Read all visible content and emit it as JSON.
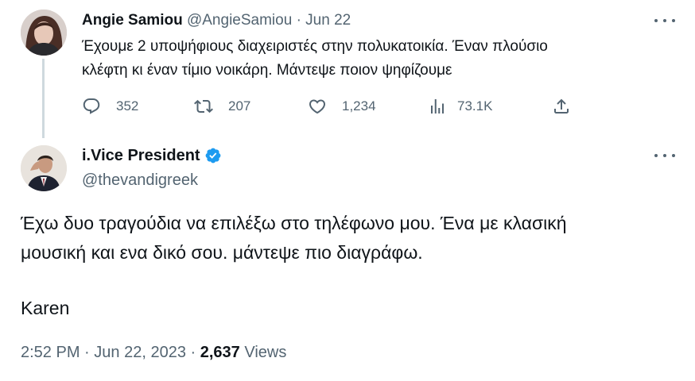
{
  "colors": {
    "text": "#0f1419",
    "secondary": "#536471",
    "verified": "#1d9bf0",
    "thread_line": "#cfd9de"
  },
  "reply_to": {
    "author_name": "Angie Samiou",
    "author_handle": "@AngieSamiou",
    "separator": "·",
    "date": "Jun 22",
    "text_line1": "Έχουμε 2 υποψήφιους διαχειριστές στην πολυκατοικία. Έναν πλούσιο",
    "text_line2": "κλέφτη κι έναν τίμιο νοικάρη. Μάντεψε ποιον ψηφίζουμε",
    "actions": [
      {
        "icon": "reply-icon",
        "count": "352"
      },
      {
        "icon": "retweet-icon",
        "count": "207"
      },
      {
        "icon": "like-icon",
        "count": "1,234"
      },
      {
        "icon": "views-icon",
        "count": "73.1K"
      },
      {
        "icon": "share-icon",
        "count": ""
      }
    ]
  },
  "tweet": {
    "author_name": "i.Vice President",
    "author_handle": "@thevandigreek",
    "verified": true,
    "text_line1": "Έχω δυο τραγούδια να επιλέξω στο τηλέφωνο μου. Ένα με κλασική",
    "text_line2": "μουσική και ενα δικό σου. μάντεψε πιο διαγράφω.",
    "signature": "Karen",
    "time": "2:52 PM",
    "separator": "·",
    "date": "Jun 22, 2023",
    "views_count": "2,637",
    "views_label": "Views"
  }
}
